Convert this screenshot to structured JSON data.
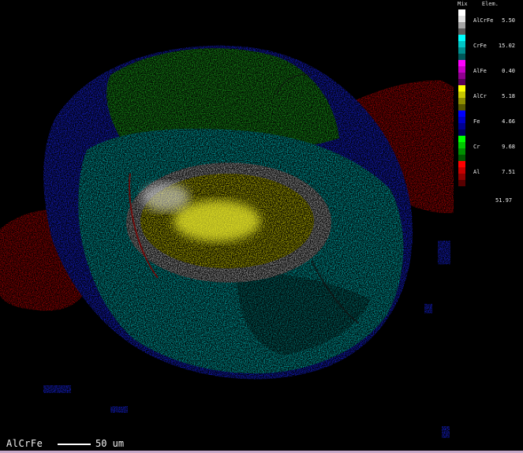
{
  "legend": {
    "headers": [
      "Mix",
      "Elem."
    ],
    "items": [
      {
        "label": "AlCrFe",
        "value": "5.50",
        "colors": [
          "#ffffff",
          "#e3e3e3",
          "#a6a6a6",
          "#5c5c5c"
        ]
      },
      {
        "label": "CrFe",
        "value": "15.02",
        "colors": [
          "#00ffff",
          "#00c6c6",
          "#008f8f",
          "#005858"
        ]
      },
      {
        "label": "AlFe",
        "value": "0.40",
        "colors": [
          "#ff00ff",
          "#c600c6",
          "#8f008f",
          "#580058"
        ]
      },
      {
        "label": "AlCr",
        "value": "5.18",
        "colors": [
          "#ffff00",
          "#c6c600",
          "#8f8f00",
          "#585800"
        ]
      },
      {
        "label": "Fe",
        "value": "4.66",
        "colors": [
          "#0000ff",
          "#0000c6",
          "#00008f",
          "#000058"
        ]
      },
      {
        "label": "Cr",
        "value": "9.68",
        "colors": [
          "#00ff00",
          "#00c600",
          "#008f00",
          "#005800"
        ]
      },
      {
        "label": "Al",
        "value": "7.51",
        "colors": [
          "#ff0000",
          "#c60000",
          "#8f0000",
          "#580000"
        ]
      }
    ],
    "total": "51.97"
  },
  "footer": {
    "label": "AlCrFe",
    "scale": "50 um"
  }
}
